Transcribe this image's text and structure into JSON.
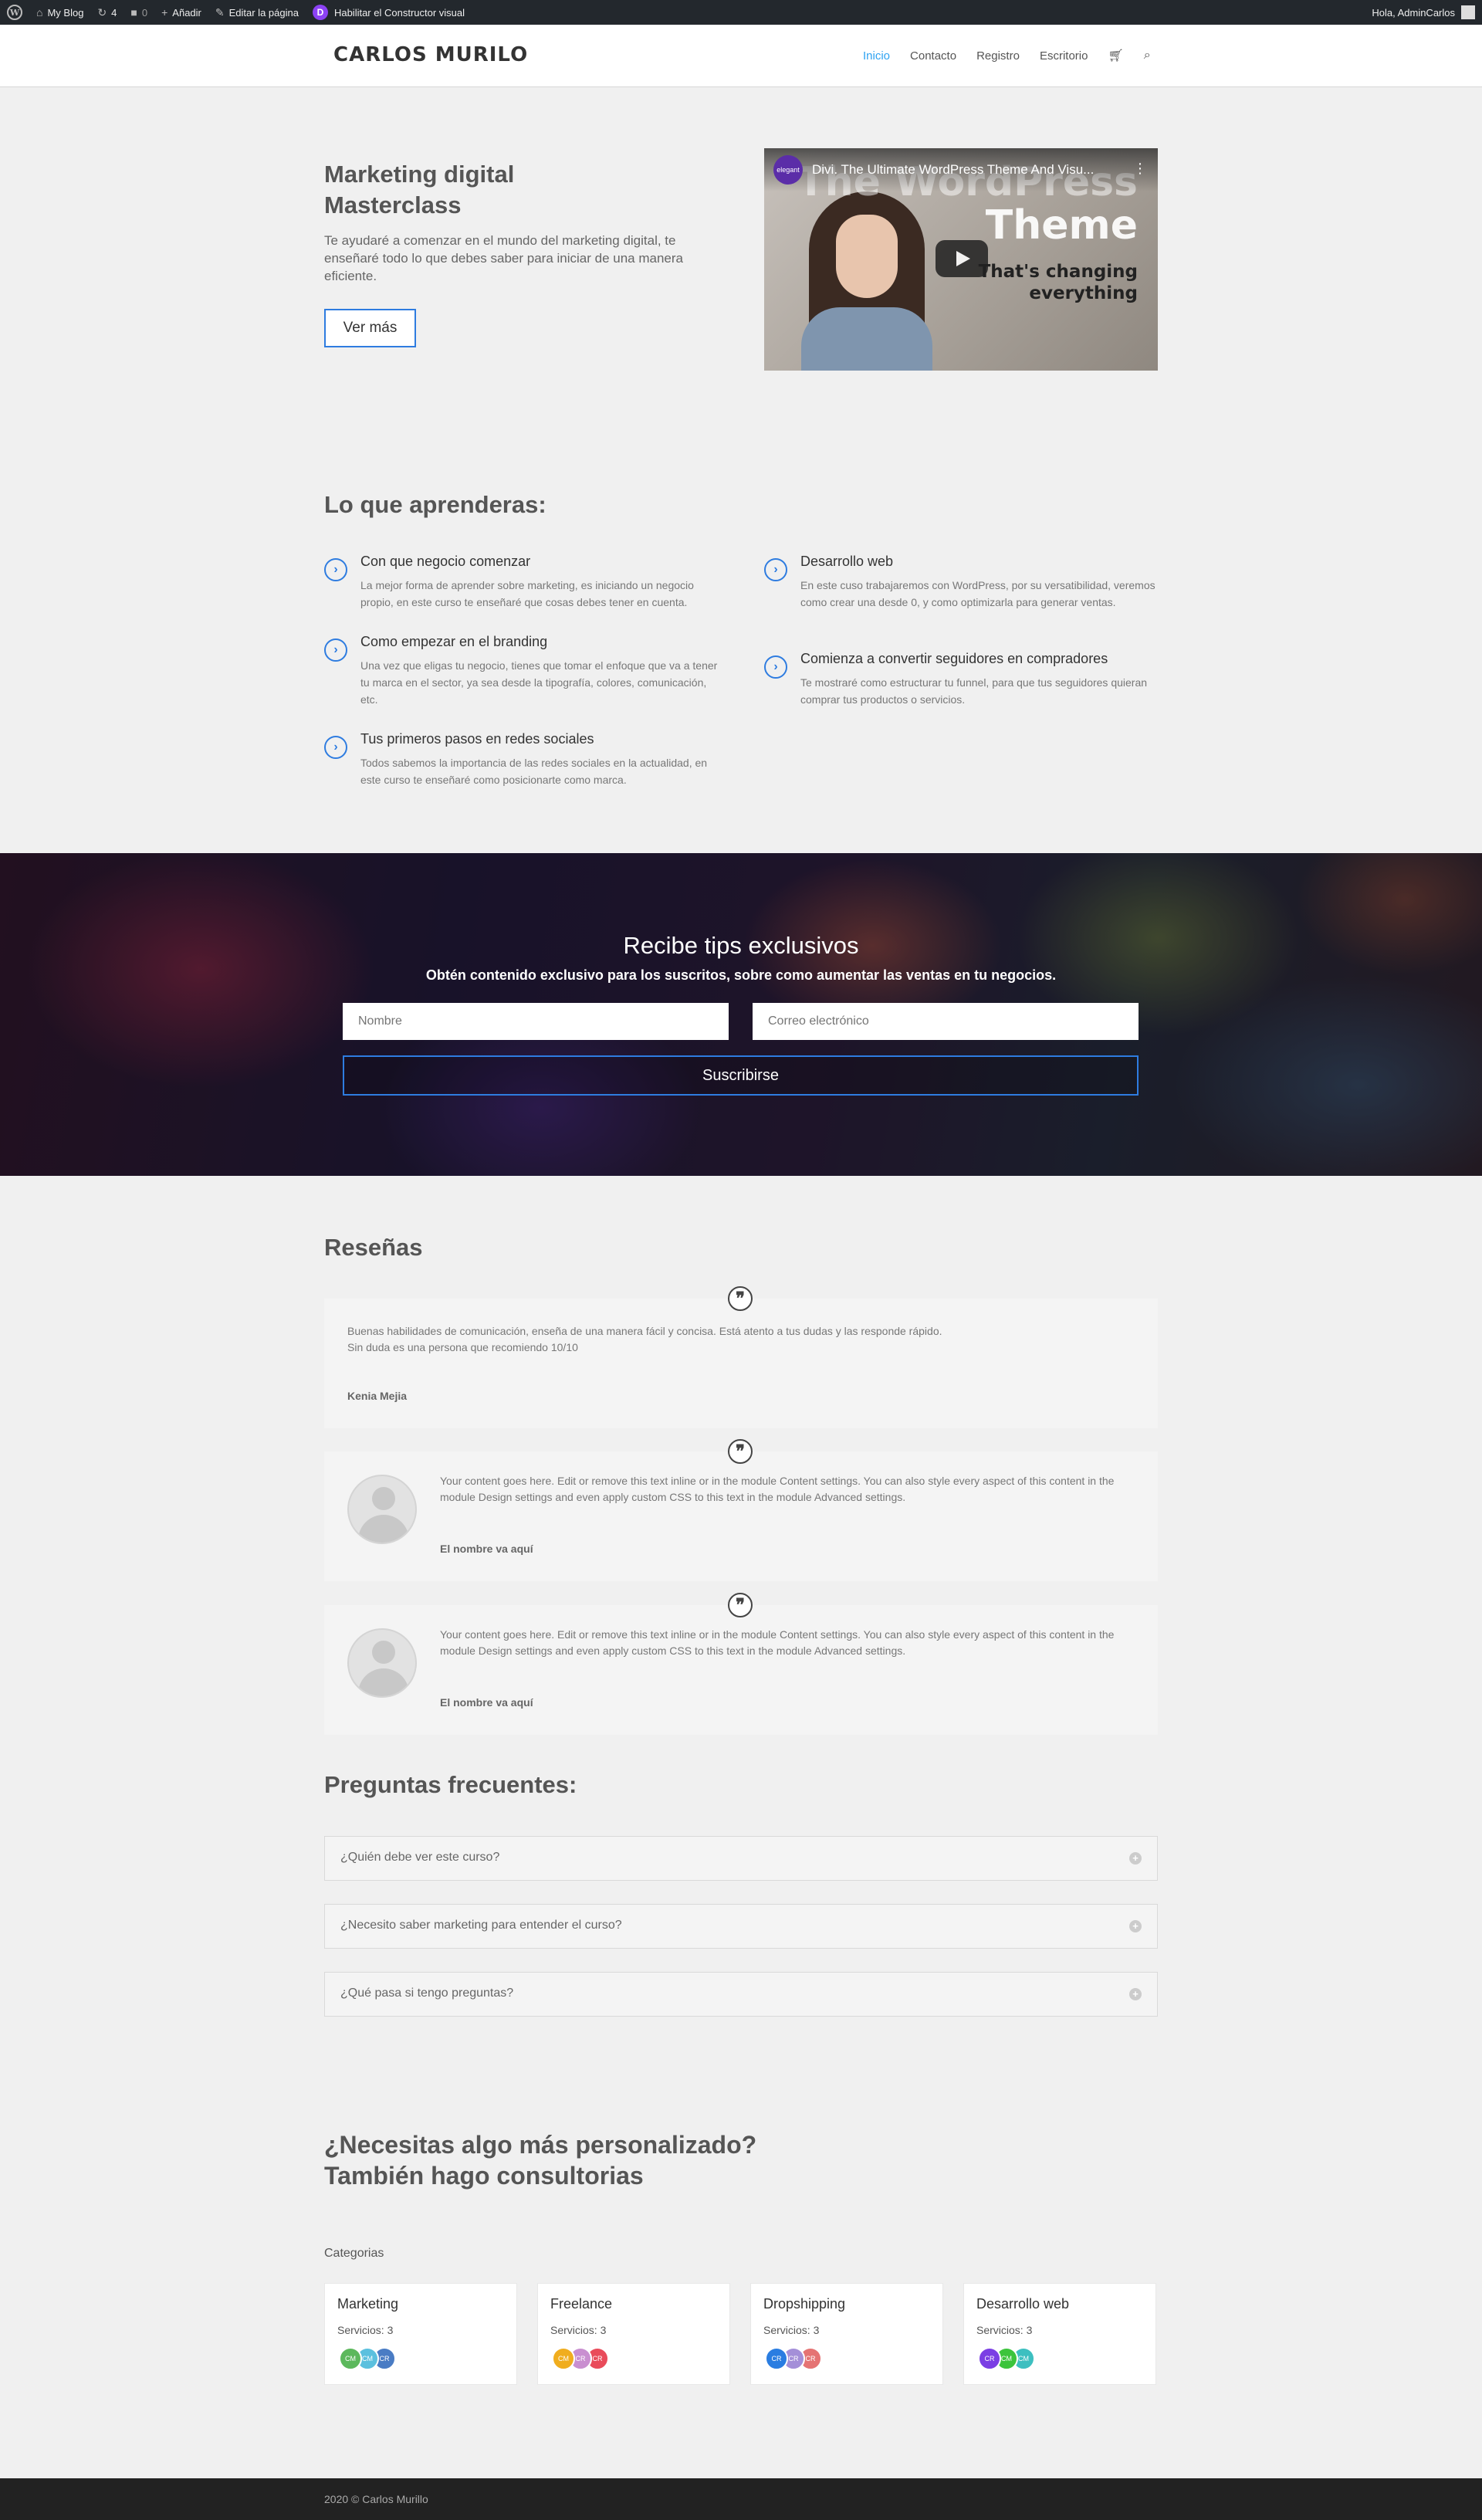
{
  "adminbar": {
    "site_name": "My Blog",
    "updates_count": "4",
    "comments_count": "0",
    "add_label": "Añadir",
    "edit_label": "Editar la página",
    "builder_label": "Habilitar el Constructor visual",
    "greeting": "Hola, AdminCarlos",
    "icons": [
      "wordpress-logo-icon",
      "home-icon",
      "updates-icon",
      "comments-icon",
      "plus-icon",
      "pencil-icon",
      "divi-icon",
      "user-avatar-icon"
    ]
  },
  "header": {
    "logo": "CARLOS MURILO",
    "nav": [
      {
        "label": "Inicio",
        "active": true
      },
      {
        "label": "Contacto"
      },
      {
        "label": "Registro"
      },
      {
        "label": "Escritorio"
      }
    ],
    "icons": [
      "cart-icon",
      "search-icon"
    ],
    "accent": "#2ea3f2"
  },
  "hero": {
    "title_line1": "Marketing digital",
    "title_line2": "Masterclass",
    "text": "Te ayudaré a comenzar en el mundo del marketing digital, te enseñaré todo lo que debes saber para iniciar de una manera eficiente.",
    "button": "Ver más",
    "video": {
      "title": "Divi. The Ultimate WordPress Theme And Visu...",
      "overlay_line1": "The WordPress",
      "overlay_line2": "Theme",
      "overlay_sub1": "That's changing",
      "overlay_sub2": "everything",
      "channel": "elegant"
    }
  },
  "learn": {
    "title": "Lo que aprenderas:",
    "items": [
      {
        "title": "Con que negocio comenzar",
        "desc": "La mejor forma de aprender sobre marketing, es iniciando un negocio propio, en este curso te enseñaré que cosas debes tener en cuenta."
      },
      {
        "title": "Como empezar en el branding",
        "desc": "Una vez que eligas tu negocio, tienes que tomar el enfoque que va a tener tu marca en el sector, ya sea desde la tipografía, colores, comunicación, etc."
      },
      {
        "title": "Tus primeros pasos en redes sociales",
        "desc": "Todos sabemos la importancia de las redes sociales en la actualidad, en este curso te enseñaré como posicionarte como marca."
      },
      {
        "title": "Desarrollo web",
        "desc": "En este cuso trabajaremos con WordPress, por su versatibilidad, veremos como crear una desde 0, y como optimizarla para generar ventas."
      },
      {
        "title": "Comienza a convertir seguidores en compradores",
        "desc": "Te mostraré como estructurar tu funnel, para que tus seguidores quieran comprar tus productos o servicios."
      }
    ]
  },
  "subscribe": {
    "title": "Recibe tips exclusivos",
    "subtitle": "Obtén contenido exclusivo para los suscritos, sobre como aumentar las ventas en tu negocios.",
    "name_placeholder": "Nombre",
    "email_placeholder": "Correo electrónico",
    "button": "Suscribirse"
  },
  "reviews": {
    "title": "Reseñas",
    "items": [
      {
        "text_line1": "Buenas habilidades de comunicación, enseña de una manera fácil y concisa. Está atento a tus dudas y las responde rápido.",
        "text_line2": "Sin duda es una persona que recomiendo 10/10",
        "author": "Kenia Mejia"
      },
      {
        "text": "Your content goes here. Edit or remove this text inline or in the module Content settings. You can also style every aspect of this content in the module Design settings and even apply custom CSS to this text in the module Advanced settings.",
        "author": "El nombre va aquí"
      },
      {
        "text": "Your content goes here. Edit or remove this text inline or in the module Content settings. You can also style every aspect of this content in the module Design settings and even apply custom CSS to this text in the module Advanced settings.",
        "author": "El nombre va aquí"
      }
    ]
  },
  "faq": {
    "title": "Preguntas frecuentes:",
    "items": [
      {
        "q": "¿Quién debe ver este curso?"
      },
      {
        "q": "¿Necesito saber marketing para entender el curso?"
      },
      {
        "q": "¿Qué pasa si tengo preguntas?"
      }
    ]
  },
  "consult": {
    "title_line1": "¿Necesitas algo más personalizado?",
    "title_line2": "También hago consultorias",
    "categories_label": "Categorias",
    "cards": [
      {
        "title": "Marketing",
        "count": "Servicios: 3",
        "avatars": [
          {
            "t": "CM",
            "c": "#5cb85c"
          },
          {
            "t": "CM",
            "c": "#5bc0de"
          },
          {
            "t": "CR",
            "c": "#4a7cc4"
          }
        ]
      },
      {
        "title": "Freelance",
        "count": "Servicios: 3",
        "avatars": [
          {
            "t": "CM",
            "c": "#f0ad1e"
          },
          {
            "t": "CR",
            "c": "#c98fd0"
          },
          {
            "t": "CR",
            "c": "#e94b5a"
          }
        ]
      },
      {
        "title": "Dropshipping",
        "count": "Servicios: 3",
        "avatars": [
          {
            "t": "CR",
            "c": "#2a7de1"
          },
          {
            "t": "CR",
            "c": "#a48fd8"
          },
          {
            "t": "CR",
            "c": "#e57373"
          }
        ]
      },
      {
        "title": "Desarrollo web",
        "count": "Servicios: 3",
        "avatars": [
          {
            "t": "CR",
            "c": "#7b3fe4"
          },
          {
            "t": "CM",
            "c": "#3cc43c"
          },
          {
            "t": "CM",
            "c": "#3dbfc0"
          }
        ]
      }
    ]
  },
  "footer": {
    "text": "2020 © Carlos Murillo"
  }
}
